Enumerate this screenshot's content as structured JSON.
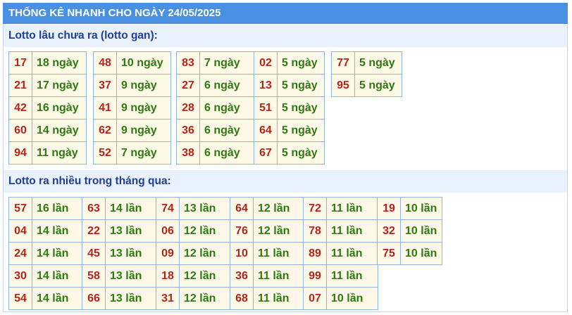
{
  "title": "THỐNG KÊ NHANH CHO NGÀY 24/05/2025",
  "sections": [
    {
      "heading": "Lotto lâu chưa ra (lotto gan):",
      "columns": [
        [
          [
            "17",
            "18 ngày"
          ],
          [
            "21",
            "17 ngày"
          ],
          [
            "42",
            "16 ngày"
          ],
          [
            "60",
            "14 ngày"
          ],
          [
            "94",
            "11 ngày"
          ]
        ],
        [
          [
            "48",
            "10 ngày"
          ],
          [
            "37",
            "9 ngày"
          ],
          [
            "41",
            "9 ngày"
          ],
          [
            "62",
            "9 ngày"
          ],
          [
            "52",
            "7 ngày"
          ]
        ],
        [
          [
            "83",
            "7 ngày"
          ],
          [
            "27",
            "6 ngày"
          ],
          [
            "28",
            "6 ngày"
          ],
          [
            "36",
            "6 ngày"
          ],
          [
            "38",
            "6 ngày"
          ]
        ],
        [
          [
            "02",
            "5 ngày"
          ],
          [
            "13",
            "5 ngày"
          ],
          [
            "51",
            "5 ngày"
          ],
          [
            "64",
            "5 ngày"
          ],
          [
            "67",
            "5 ngày"
          ]
        ],
        [
          [
            "77",
            "5 ngày"
          ],
          [
            "95",
            "5 ngày"
          ]
        ]
      ]
    },
    {
      "heading": "Lotto ra nhiều trong tháng qua:",
      "columns": [
        [
          [
            "57",
            "16 lần"
          ],
          [
            "04",
            "14 lần"
          ],
          [
            "24",
            "14 lần"
          ],
          [
            "30",
            "14 lần"
          ],
          [
            "54",
            "14 lần"
          ]
        ],
        [
          [
            "63",
            "14 lần"
          ],
          [
            "22",
            "13 lần"
          ],
          [
            "45",
            "13 lần"
          ],
          [
            "58",
            "13 lần"
          ],
          [
            "66",
            "13 lần"
          ]
        ],
        [
          [
            "74",
            "13 lần"
          ],
          [
            "06",
            "12 lần"
          ],
          [
            "09",
            "12 lần"
          ],
          [
            "18",
            "12 lần"
          ],
          [
            "31",
            "12 lần"
          ]
        ],
        [
          [
            "64",
            "12 lần"
          ],
          [
            "76",
            "12 lần"
          ],
          [
            "10",
            "11 lần"
          ],
          [
            "36",
            "11 lần"
          ],
          [
            "68",
            "11 lần"
          ]
        ],
        [
          [
            "72",
            "11 lần"
          ],
          [
            "78",
            "11 lần"
          ],
          [
            "89",
            "11 lần"
          ],
          [
            "99",
            "11 lần"
          ],
          [
            "07",
            "10 lần"
          ]
        ],
        [
          [
            "19",
            "10 lần"
          ],
          [
            "32",
            "10 lần"
          ],
          [
            "75",
            "10 lần"
          ]
        ]
      ]
    }
  ]
}
